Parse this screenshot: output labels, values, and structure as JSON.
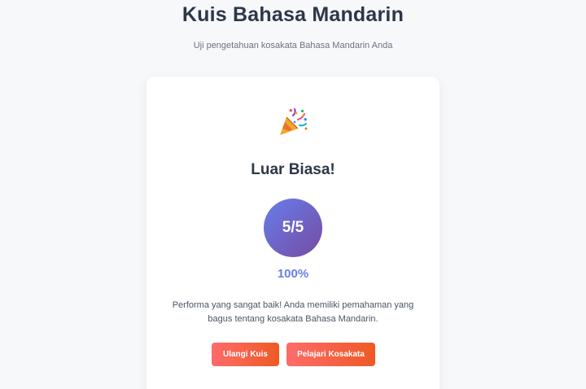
{
  "header": {
    "title": "Kuis Bahasa Mandarin",
    "subtitle": "Uji pengetahuan kosakata Bahasa Mandarin Anda"
  },
  "result": {
    "icon": "party-popper-icon",
    "heading": "Luar Biasa!",
    "score": "5/5",
    "percentage": "100%",
    "message": "Performa yang sangat baik! Anda memiliki pemahaman yang bagus tentang kosakata Bahasa Mandarin."
  },
  "actions": {
    "retry_label": "Ulangi Kuis",
    "learn_label": "Pelajari Kosakata"
  },
  "colors": {
    "score_gradient": [
      "#667eea",
      "#764ba2"
    ],
    "button_gradient": [
      "#ff6b6b",
      "#ee5a24"
    ],
    "heading": "#2d3748"
  }
}
